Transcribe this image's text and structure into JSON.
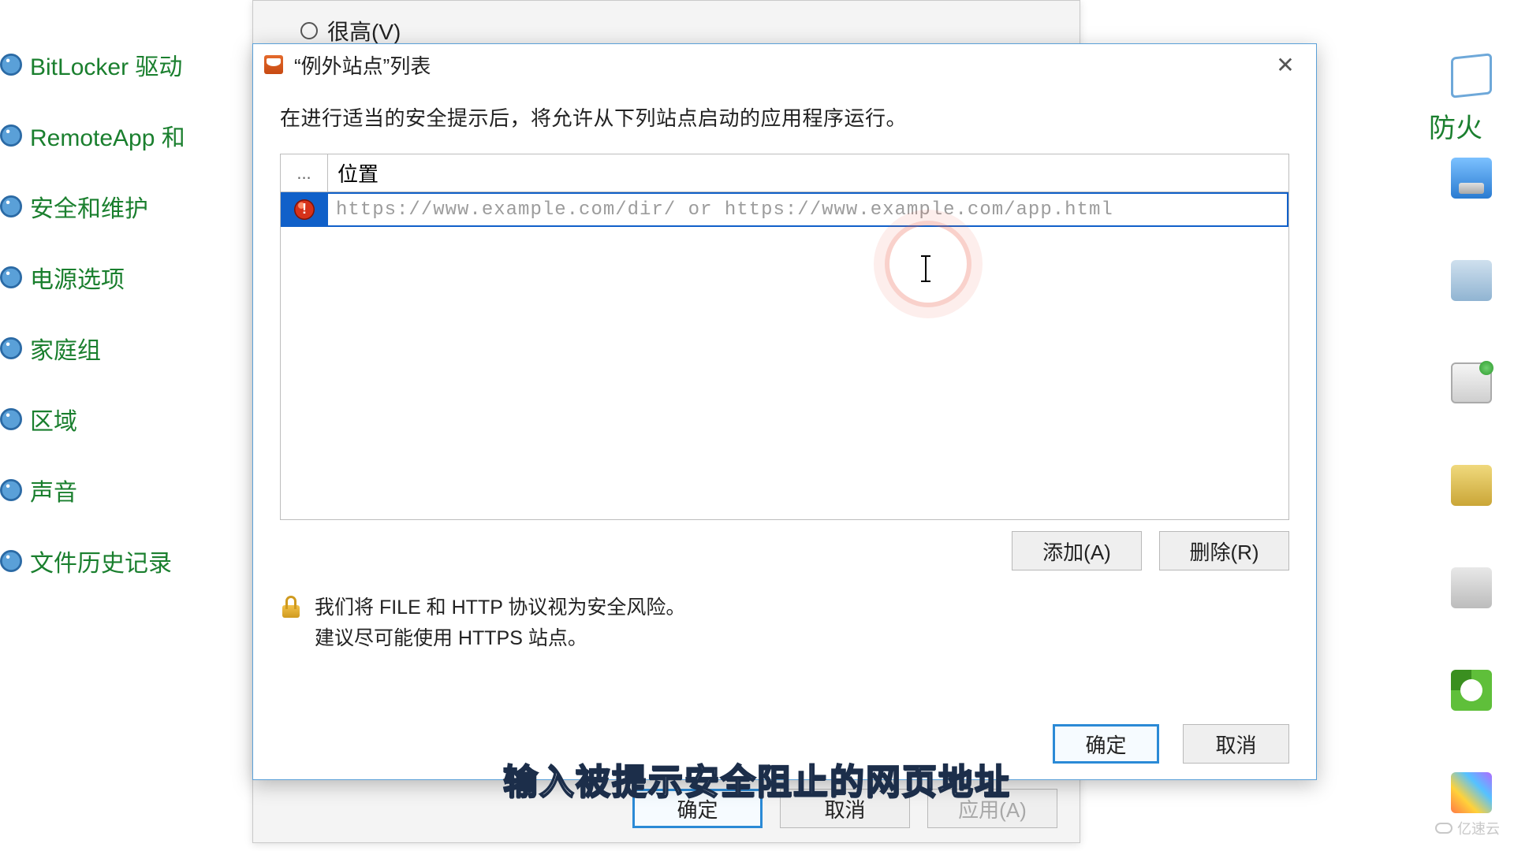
{
  "parent_dialog": {
    "radio_very_high": "很高(V)",
    "ok": "确定",
    "cancel": "取消",
    "apply": "应用(A)"
  },
  "cp_left": {
    "bitlocker": "BitLocker 驱动",
    "remoteapp": "RemoteApp 和",
    "security": "安全和维护",
    "power": "电源选项",
    "homegroup": "家庭组",
    "region": "区域",
    "sound": "声音",
    "filehistory": "文件历史记录"
  },
  "peek_right": "防火",
  "dialog": {
    "title": "“例外站点”列表",
    "description": "在进行适当的安全提示后，将允许从下列站点启动的应用程序运行。",
    "header_icon": "...",
    "header_location": "位置",
    "row_placeholder": "https://www.example.com/dir/ or https://www.example.com/app.html",
    "row_value": "",
    "add": "添加(A)",
    "remove": "删除(R)",
    "hint_line1": "我们将 FILE 和 HTTP 协议视为安全风险。",
    "hint_line2": "建议尽可能使用 HTTPS 站点。",
    "ok": "确定",
    "cancel": "取消"
  },
  "caption": "输入被提示安全阻止的网页地址",
  "watermark": "亿速云"
}
